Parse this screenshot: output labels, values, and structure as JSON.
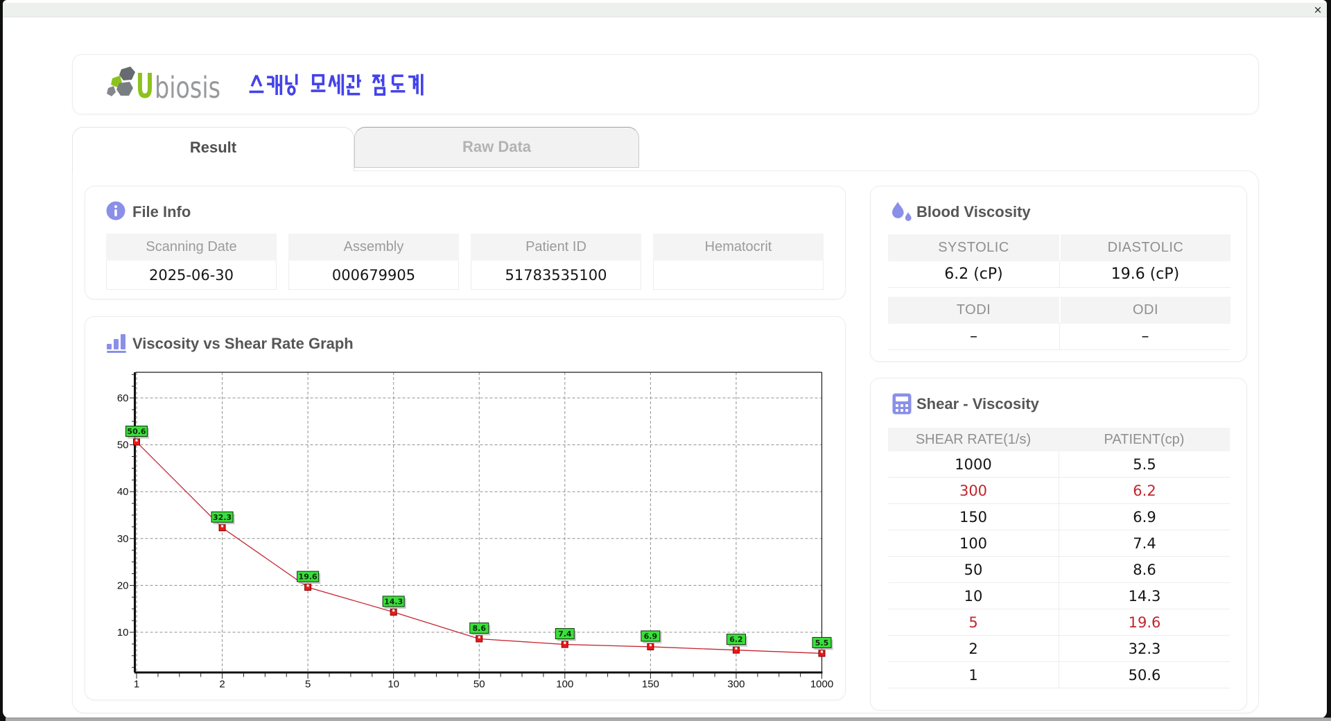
{
  "window": {
    "close_label": "×"
  },
  "header": {
    "brand_first": "U",
    "brand_rest": "biosis",
    "app_title_korean": "스캐닝 모세관 점도계"
  },
  "tabs": [
    {
      "label": "Result",
      "active": true
    },
    {
      "label": "Raw Data",
      "active": false
    }
  ],
  "file_info": {
    "title": "File Info",
    "fields": [
      {
        "label": "Scanning Date",
        "value": "2025-06-30"
      },
      {
        "label": "Assembly",
        "value": "000679905"
      },
      {
        "label": "Patient ID",
        "value": "51783535100"
      },
      {
        "label": "Hematocrit",
        "value": ""
      }
    ]
  },
  "blood_viscosity": {
    "title": "Blood Viscosity",
    "groups": [
      {
        "cells": [
          {
            "label": "SYSTOLIC",
            "value": "6.2 (cP)"
          },
          {
            "label": "DIASTOLIC",
            "value": "19.6 (cP)"
          }
        ]
      },
      {
        "cells": [
          {
            "label": "TODI",
            "value": "–"
          },
          {
            "label": "ODI",
            "value": "–"
          }
        ]
      }
    ]
  },
  "shear_viscosity": {
    "title": "Shear - Viscosity",
    "columns": [
      "SHEAR RATE(1/s)",
      "PATIENT(cp)"
    ],
    "rows": [
      {
        "shear_rate": "1000",
        "patient": "5.5",
        "highlight": false
      },
      {
        "shear_rate": "300",
        "patient": "6.2",
        "highlight": true
      },
      {
        "shear_rate": "150",
        "patient": "6.9",
        "highlight": false
      },
      {
        "shear_rate": "100",
        "patient": "7.4",
        "highlight": false
      },
      {
        "shear_rate": "50",
        "patient": "8.6",
        "highlight": false
      },
      {
        "shear_rate": "10",
        "patient": "14.3",
        "highlight": false
      },
      {
        "shear_rate": "5",
        "patient": "19.6",
        "highlight": true
      },
      {
        "shear_rate": "2",
        "patient": "32.3",
        "highlight": false
      },
      {
        "shear_rate": "1",
        "patient": "50.6",
        "highlight": false
      }
    ]
  },
  "graph": {
    "title": "Viscosity vs Shear Rate Graph"
  },
  "chart_data": {
    "type": "line",
    "title": "Viscosity vs Shear Rate Graph",
    "categories": [
      "1",
      "2",
      "5",
      "10",
      "50",
      "100",
      "150",
      "300",
      "1000"
    ],
    "x": [
      1,
      2,
      5,
      10,
      50,
      100,
      150,
      300,
      1000
    ],
    "values": [
      50.6,
      32.3,
      19.6,
      14.3,
      8.6,
      7.4,
      6.9,
      6.2,
      5.5
    ],
    "point_labels": [
      "50.6",
      "32.3",
      "19.6",
      "14.3",
      "8.6",
      "7.4",
      "6.9",
      "6.2",
      "5.5"
    ],
    "xlabel": "",
    "ylabel": "",
    "y_ticks": [
      10,
      20,
      30,
      40,
      50,
      60
    ],
    "ylim": [
      1.4,
      65.5
    ],
    "grid": true,
    "legend": false,
    "series_color": "#c42530",
    "marker_color": "#ea1a1a",
    "label_bg": "#3adf3a"
  },
  "colors": {
    "accent_periwinkle": "#8a8fe8",
    "brand_green": "#8dc21e",
    "brand_gray": "#97999b",
    "korean_blue": "#4343ea",
    "highlight_red": "#c2262b",
    "titlebar": "#edf1ee"
  }
}
